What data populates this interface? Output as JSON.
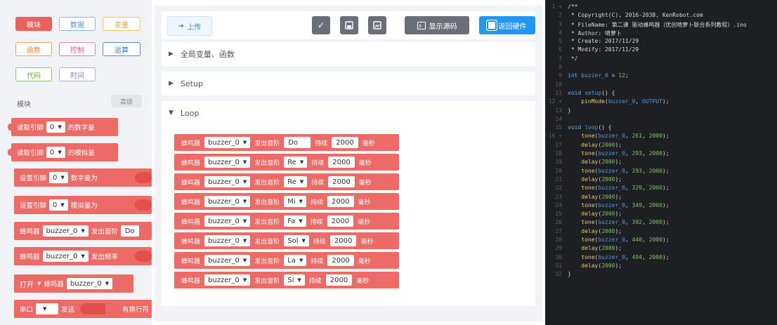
{
  "toolbox": {
    "categories": [
      {
        "label": "模块",
        "color": "#e9605c",
        "active": true
      },
      {
        "label": "数据",
        "color": "#8fb4e8"
      },
      {
        "label": "变量",
        "color": "#f2c35c"
      },
      {
        "label": "函数",
        "color": "#f2a25c"
      },
      {
        "label": "控制",
        "color": "#e080b8"
      },
      {
        "label": "运算",
        "color": "#4f8ed8"
      },
      {
        "label": "代码",
        "color": "#8cd05c"
      },
      {
        "label": "时间",
        "color": "#b7a9e0"
      }
    ],
    "section_label": "模块",
    "advanced_label": "高级",
    "blocks": {
      "b1": {
        "a": "读取引脚",
        "pin": "0",
        "b": "的数字量"
      },
      "b2": {
        "a": "读取引脚",
        "pin": "0",
        "b": "的模拟量"
      },
      "b3": {
        "a": "设置引脚",
        "pin": "0",
        "b": "数字量为"
      },
      "b4": {
        "a": "设置引脚",
        "pin": "0",
        "b": "模拟量为"
      },
      "b5": {
        "a": "蜂鸣器",
        "dev": "buzzer_0",
        "b": "发出音阶",
        "note": "Do"
      },
      "b6": {
        "a": "蜂鸣器",
        "dev": "buzzer_0",
        "b": "发出频率"
      },
      "b7": {
        "mode": "打开",
        "a": "蜂鸣器",
        "dev": "buzzer_0"
      },
      "b8": {
        "a": "串口",
        "sel": "",
        "b": "发送",
        "c": "有换行符"
      }
    }
  },
  "toolbar": {
    "upload_label": "上传",
    "show_source_label": "显示源码",
    "back_hw_label": "返回硬件"
  },
  "panels": {
    "globals": "全局变量、函数",
    "setup": "Setup",
    "loop": "Loop"
  },
  "loop_block": {
    "label_a": "蜂鸣器",
    "device": "buzzer_0",
    "label_b": "发出音阶",
    "label_c": "持续",
    "label_d": "毫秒",
    "rows": [
      {
        "note": "Do",
        "duration": "2000"
      },
      {
        "note": "Re",
        "duration": "2000"
      },
      {
        "note": "Re",
        "duration": "2000"
      },
      {
        "note": "Mi",
        "duration": "2000"
      },
      {
        "note": "Fa",
        "duration": "2000"
      },
      {
        "note": "Sol",
        "duration": "2000"
      },
      {
        "note": "La",
        "duration": "2000"
      },
      {
        "note": "Si",
        "duration": "2000"
      }
    ]
  },
  "code": {
    "lines": [
      "/**",
      " * Copyright(C), 2016-2038, KenRobot.com",
      " * FileName: 第二课 驱动蜂鸣器（优创啃萝卜联合系列教程）.ino",
      " * Author: 啃萝卜",
      " * Create: 2017/11/29",
      " * Modify: 2017/11/29",
      " */",
      "",
      "int buzzer_0 = 12;",
      "",
      "void setup() {",
      "    pinMode(buzzer_0, OUTPUT);",
      "}",
      "",
      "void loop() {",
      "    tone(buzzer_0, 261, 2000);",
      "    delay(2000);",
      "    tone(buzzer_0, 293, 2000);",
      "    delay(2000);",
      "    tone(buzzer_0, 293, 2000);",
      "    delay(2000);",
      "    tone(buzzer_0, 329, 2000);",
      "    delay(2000);",
      "    tone(buzzer_0, 349, 2000);",
      "    delay(2000);",
      "    tone(buzzer_0, 392, 2000);",
      "    delay(2000);",
      "    tone(buzzer_0, 440, 2000);",
      "    delay(2000);",
      "    tone(buzzer_0, 494, 2000);",
      "    delay(2000);",
      "}"
    ],
    "line_numbers": [
      "1 ▾",
      "2",
      "3",
      "4",
      "5",
      "6",
      "7",
      "8",
      "9",
      "10",
      "11",
      "12 ▾",
      "13",
      "14",
      "15",
      "16 ▾",
      "17",
      "18",
      "19",
      "20",
      "21",
      "22",
      "23",
      "24",
      "25",
      "26",
      "27",
      "28",
      "29",
      "30",
      "31",
      "32"
    ]
  }
}
